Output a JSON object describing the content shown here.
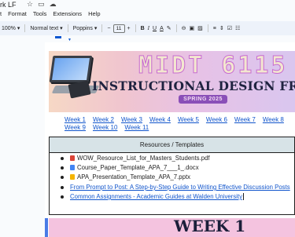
{
  "document": {
    "title": "rk LF",
    "title_icons": [
      "star-icon",
      "folder-icon",
      "cloud-icon"
    ]
  },
  "menu": {
    "items": [
      "Format",
      "Tools",
      "Extensions",
      "Help"
    ],
    "partial_first": "t"
  },
  "toolbar": {
    "zoom": "100%",
    "style": "Normal text",
    "font": "Poppins",
    "font_size": "11",
    "minus": "−",
    "plus": "+",
    "bold": "B",
    "italic": "I",
    "underline": "U",
    "text_color": "A"
  },
  "banner": {
    "title": "MIDT 6115",
    "subtitle": "INSTRUCTIONAL DESIGN FRAMEWORK",
    "pill": "SPRING 2025"
  },
  "weeks": {
    "row1": [
      "Week 1",
      "Week 2",
      "Week 3",
      "Week 4",
      "Week 5",
      "Week 6",
      "Week 7",
      "Week 8"
    ],
    "row2": [
      "Week 9",
      "Week 10",
      "Week 11"
    ]
  },
  "resources": {
    "header": "Resources / Templates",
    "items": [
      {
        "kind": "pdf",
        "label": "WOW_Resource_List_for_Masters_Students.pdf"
      },
      {
        "kind": "docx",
        "label": "Course_Paper_Template_APA_7___1_.docx"
      },
      {
        "kind": "pptx",
        "label": "APA_Presentation_Template_APA_7.pptx"
      },
      {
        "kind": "link",
        "label": "From Prompt to Post: A Step-by-Step Guide to Writing Effective Discussion Posts"
      },
      {
        "kind": "link",
        "label": "Common Assignments - Academic Guides at Walden University"
      }
    ]
  },
  "section": {
    "title": "WEEK 1"
  },
  "colors": {
    "accent": "#0b57d0",
    "link": "#1155cc",
    "table_header": "#d7e3e7",
    "week_bar": "#f4c3df"
  }
}
